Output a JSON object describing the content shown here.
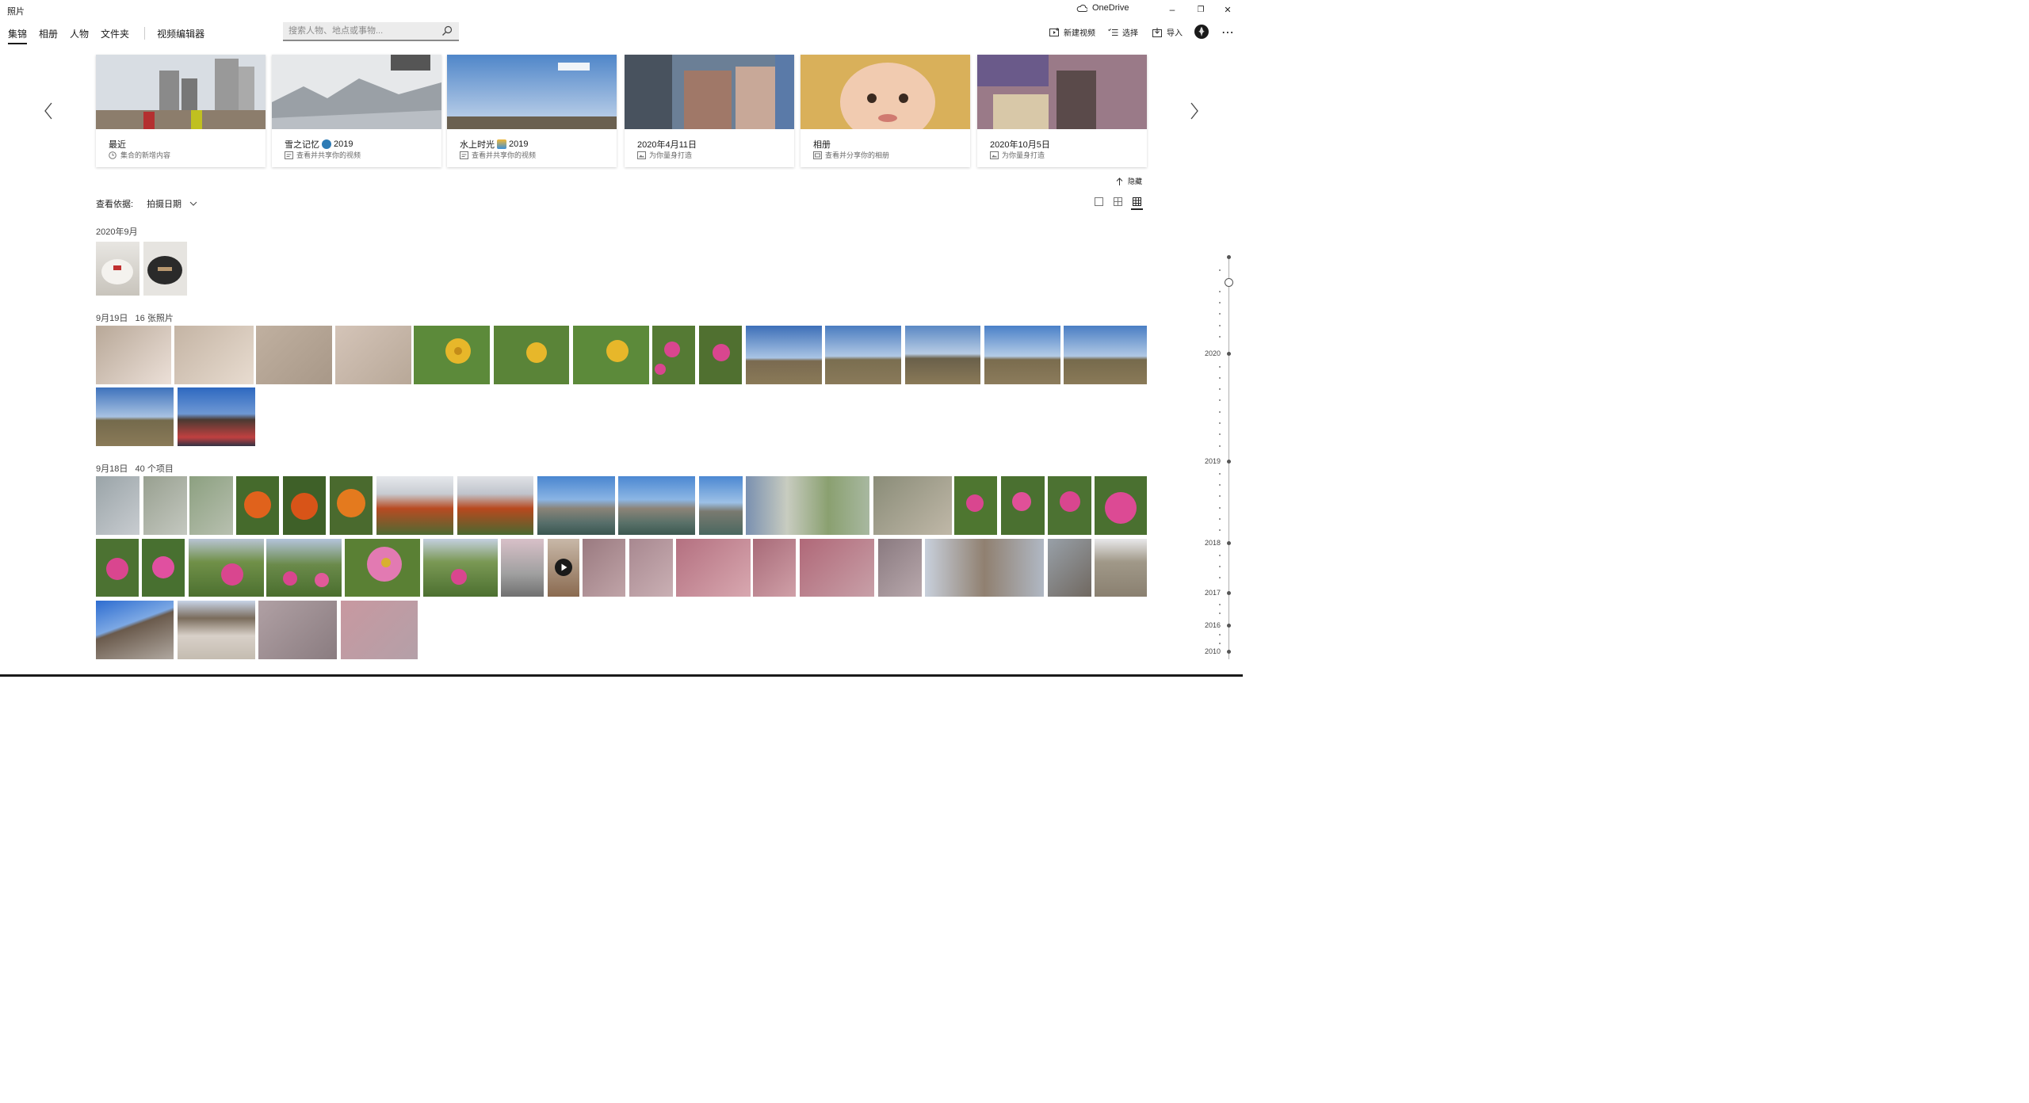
{
  "app": {
    "title": "照片",
    "onedrive_label": "OneDrive"
  },
  "window": {
    "minimize": "–",
    "restore": "❐",
    "close": "✕"
  },
  "nav": {
    "tabs": [
      "集锦",
      "相册",
      "人物",
      "文件夹"
    ],
    "active": 0,
    "video_editor": "视频编辑器"
  },
  "search": {
    "placeholder": "搜索人物、地点或事物..."
  },
  "toolbar": {
    "new_video": "新建视频",
    "select": "选择",
    "import": "导入",
    "more": "⋯"
  },
  "collections": [
    {
      "title": "最近",
      "emoji": "",
      "year": "",
      "subtitle": "集合的新增内容",
      "icon": "clock-icon"
    },
    {
      "title": "雪之记忆",
      "emoji": "snowflake",
      "year": "2019",
      "subtitle": "查看并共享你的视频",
      "icon": "video-icon"
    },
    {
      "title": "水上时光",
      "emoji": "beach",
      "year": "2019",
      "subtitle": "查看并共享你的视频",
      "icon": "video-icon"
    },
    {
      "title": "2020年4月11日",
      "emoji": "",
      "year": "",
      "subtitle": "为你量身打造",
      "icon": "photo-icon"
    },
    {
      "title": "相册",
      "emoji": "",
      "year": "",
      "subtitle": "查看并分享你的相册",
      "icon": "album-icon"
    },
    {
      "title": "2020年10月5日",
      "emoji": "",
      "year": "",
      "subtitle": "为你量身打造",
      "icon": "photo-icon"
    }
  ],
  "hide_label": "隐藏",
  "view_by": {
    "label": "查看依据:",
    "value": "拍摄日期"
  },
  "sections": {
    "s1": {
      "date": "2020年9月",
      "count": ""
    },
    "s2": {
      "date": "9月19日",
      "count": "16 张照片"
    },
    "s3": {
      "date": "9月18日",
      "count": "40 个项目"
    }
  },
  "timeline": {
    "years": [
      "2020",
      "2019",
      "2018",
      "2017",
      "2016",
      "2010"
    ]
  },
  "colors": {
    "accent": "#1a1a1a",
    "sky": "#4f86c9",
    "flower_yellow": "#e7b72a",
    "flower_pink": "#d9468f",
    "marigold": "#e0621c"
  }
}
